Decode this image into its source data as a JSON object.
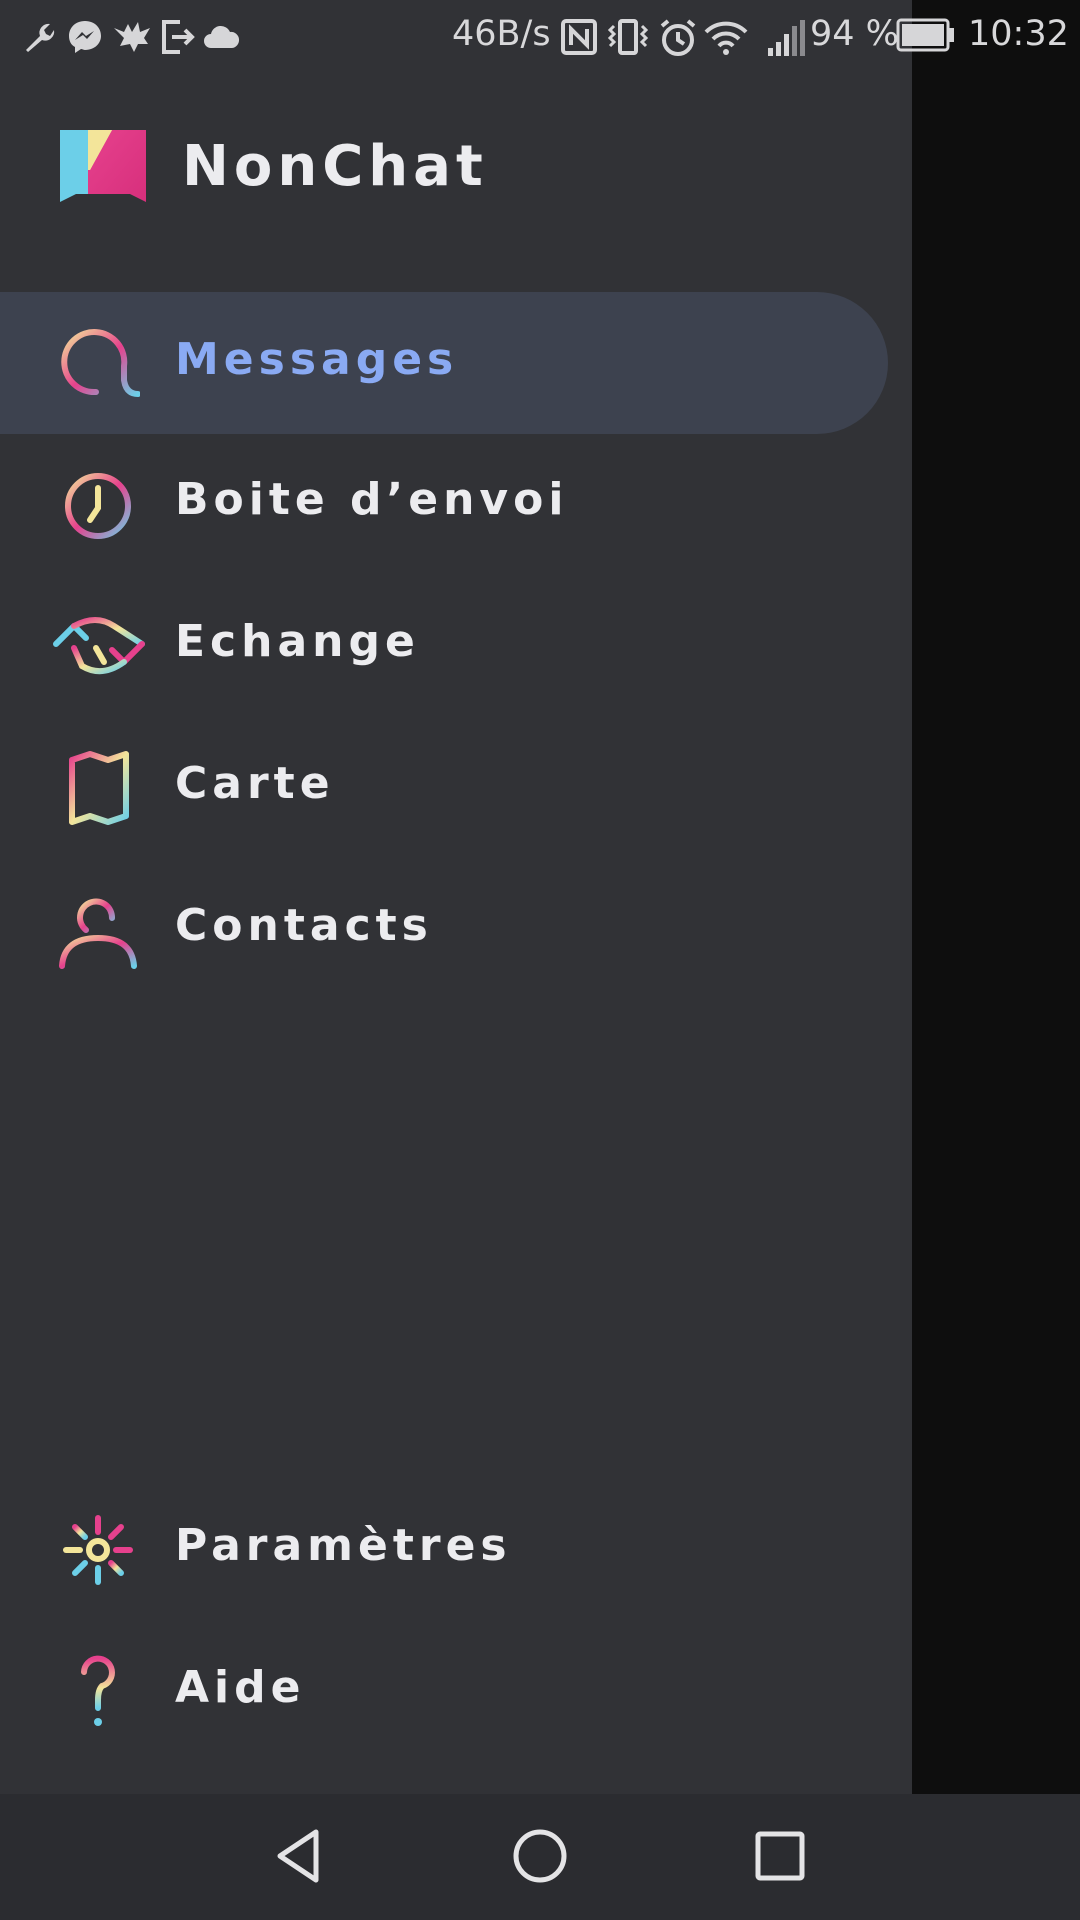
{
  "status_bar": {
    "network_speed": "46B/s",
    "battery_percent": "94 %",
    "time": "10:32",
    "left_icons": [
      "wrench-icon",
      "messenger-icon",
      "bird-icon",
      "exit-icon",
      "cloud-icon"
    ],
    "right_icons": [
      "nfc-icon",
      "vibrate-icon",
      "alarm-icon",
      "wifi-icon",
      "signal-icon",
      "battery-icon"
    ]
  },
  "app": {
    "title": "NonChat"
  },
  "menu": {
    "items": [
      {
        "label": "Messages",
        "icon": "messages-icon",
        "active": true
      },
      {
        "label": "Boite d’envoi",
        "icon": "clock-icon",
        "active": false
      },
      {
        "label": "Echange",
        "icon": "exchange-icon",
        "active": false
      },
      {
        "label": "Carte",
        "icon": "map-icon",
        "active": false
      },
      {
        "label": "Contacts",
        "icon": "contact-icon",
        "active": false
      }
    ],
    "bottom_items": [
      {
        "label": "Paramètres",
        "icon": "settings-icon"
      },
      {
        "label": "Aide",
        "icon": "help-icon"
      }
    ]
  },
  "colors": {
    "drawer_bg": "#313236",
    "active_bg": "#3d424f",
    "active_text": "#8aaaf3",
    "text": "#ececef",
    "accent_pink": "#e6418d",
    "accent_blue": "#6ccfe8",
    "accent_yellow": "#f3e59a"
  },
  "nav_bar": {
    "buttons": [
      "back-icon",
      "home-icon",
      "recents-icon"
    ]
  }
}
